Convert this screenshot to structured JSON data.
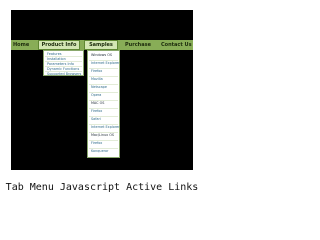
{
  "menu": {
    "top_items": [
      "Home",
      "Product Info",
      "Samples",
      "Purchase",
      "Contact Us"
    ]
  },
  "product_info_menu": [
    "Features",
    "Installation",
    "Parameters Info",
    "Dynamic Functions",
    "Supported Browsers"
  ],
  "samples_menu": [
    "Windows OS",
    "Internet Explorer",
    "Firefox",
    "Mozilla",
    "Netscape",
    "Opera",
    "MAC OS",
    "Firefox",
    "Safari",
    "Internet Explorer",
    "Mac/Linux OS",
    "Firefox",
    "Konqueror"
  ],
  "caption": "Tab Menu Javascript Active Links",
  "colors": {
    "menu_bar": "#88ad57",
    "active_tab": "#d3e6b3",
    "link": "#2d6a8a"
  }
}
